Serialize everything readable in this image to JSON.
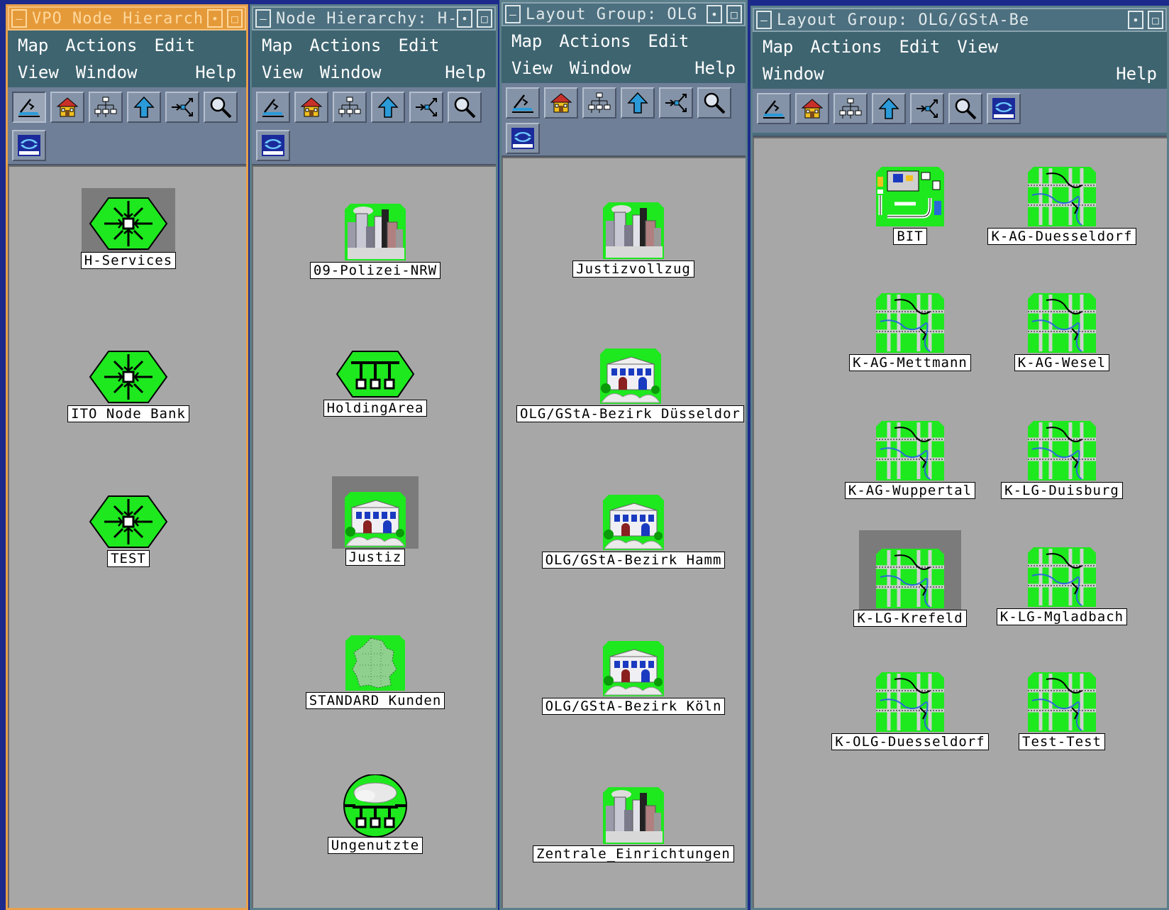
{
  "windows": [
    {
      "title": "VPO Node Hierarch",
      "active": true,
      "menus": [
        [
          "Map",
          "Actions",
          "Edit"
        ],
        [
          "View",
          "Window",
          "",
          "Help"
        ]
      ],
      "nodes": [
        {
          "label": "H-Services",
          "icon": "hex-network",
          "selected": true
        },
        {
          "label": "ITO Node Bank",
          "icon": "hex-network",
          "selected": false
        },
        {
          "label": "TEST",
          "icon": "hex-network",
          "selected": false
        }
      ]
    },
    {
      "title": "Node Hierarchy: H-",
      "active": false,
      "menus": [
        [
          "Map",
          "Actions",
          "Edit"
        ],
        [
          "View",
          "Window",
          "",
          "Help"
        ]
      ],
      "nodes": [
        {
          "label": "09-Polizei-NRW",
          "icon": "city",
          "selected": false
        },
        {
          "label": "HoldingArea",
          "icon": "hex-holding",
          "selected": false
        },
        {
          "label": "Justiz",
          "icon": "building",
          "selected": true
        },
        {
          "label": "STANDARD Kunden",
          "icon": "germany-map",
          "selected": false
        },
        {
          "label": "Ungenutzte",
          "icon": "cloud-network",
          "selected": false
        }
      ]
    },
    {
      "title": "Layout Group: OLG",
      "active": false,
      "menus": [
        [
          "Map",
          "Actions",
          "Edit"
        ],
        [
          "View",
          "Window",
          "",
          "Help"
        ]
      ],
      "nodes": [
        {
          "label": "Justizvollzug",
          "icon": "city",
          "selected": false
        },
        {
          "label": "OLG/GStA-Bezirk Düsseldor",
          "icon": "building",
          "selected": false
        },
        {
          "label": "OLG/GStA-Bezirk Hamm",
          "icon": "building",
          "selected": false
        },
        {
          "label": "OLG/GStA-Bezirk Köln",
          "icon": "building",
          "selected": false
        },
        {
          "label": "Zentrale_Einrichtungen",
          "icon": "city",
          "selected": false
        }
      ]
    },
    {
      "title": "Layout Group: OLG/GStA-Be",
      "active": false,
      "menus": [
        [
          "Map",
          "Actions",
          "Edit",
          "View"
        ],
        [
          "Window",
          "",
          "Help"
        ]
      ],
      "nodes": [
        {
          "label": "BIT",
          "icon": "site-plan",
          "selected": false
        },
        {
          "label": "K-AG-Duesseldorf",
          "icon": "street-map",
          "selected": false
        },
        {
          "label": "K-AG-Mettmann",
          "icon": "street-map",
          "selected": false
        },
        {
          "label": "K-AG-Wesel",
          "icon": "street-map",
          "selected": false
        },
        {
          "label": "K-AG-Wuppertal",
          "icon": "street-map",
          "selected": false
        },
        {
          "label": "K-LG-Duisburg",
          "icon": "street-map",
          "selected": false
        },
        {
          "label": "K-LG-Krefeld",
          "icon": "street-map",
          "selected": true
        },
        {
          "label": "K-LG-Mgladbach",
          "icon": "street-map",
          "selected": false
        },
        {
          "label": "K-OLG-Duesseldorf",
          "icon": "street-map",
          "selected": false
        },
        {
          "label": "Test-Test",
          "icon": "street-map",
          "selected": false
        }
      ]
    }
  ],
  "toolbar_icons": [
    "close-level-icon",
    "home-icon",
    "hierarchy-icon",
    "parent-up-icon",
    "quick-nav-icon",
    "find-icon",
    "hp-openview-icon"
  ],
  "colors": {
    "green": "#1ee81e",
    "canvas": "#a7a7a7",
    "title_active": "#e59a3a",
    "menubar": "#3e6470"
  }
}
